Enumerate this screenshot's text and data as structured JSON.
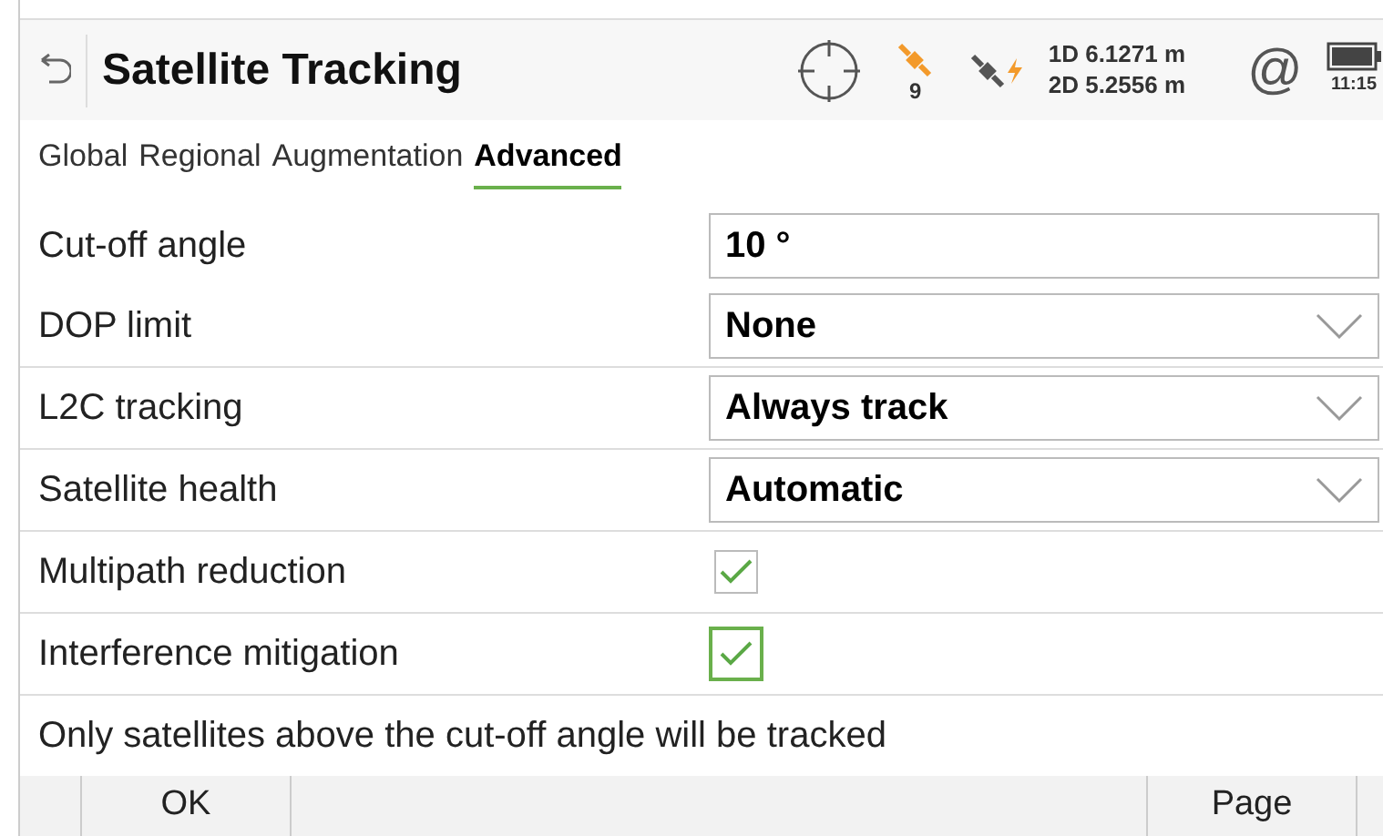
{
  "header": {
    "title": "Satellite Tracking",
    "satellites_in_use": "9",
    "precision": [
      "1D 6.1271 m",
      "2D 5.2556 m"
    ],
    "connection_symbol": "@",
    "time": "11:15"
  },
  "tabs": [
    {
      "label": "Global",
      "selected": false
    },
    {
      "label": "Regional",
      "selected": false
    },
    {
      "label": "Augmentation",
      "selected": false
    },
    {
      "label": "Advanced",
      "selected": true
    }
  ],
  "fields": [
    {
      "kind": "text",
      "label": "Cut-off angle",
      "value": "10 °"
    },
    {
      "kind": "dropdown",
      "label": "DOP limit",
      "value": "None"
    },
    {
      "kind": "dropdown",
      "label": "L2C tracking",
      "value": "Always track"
    },
    {
      "kind": "dropdown",
      "label": "Satellite health",
      "value": "Automatic"
    },
    {
      "kind": "checkbox",
      "label": "Multipath reduction",
      "checked": true,
      "focused": false
    },
    {
      "kind": "checkbox",
      "label": "Interference mitigation",
      "checked": true,
      "focused": true
    }
  ],
  "hint": "Only satellites above the cut-off angle will be tracked",
  "footer": {
    "left_button": "OK",
    "right_button": "Page"
  }
}
